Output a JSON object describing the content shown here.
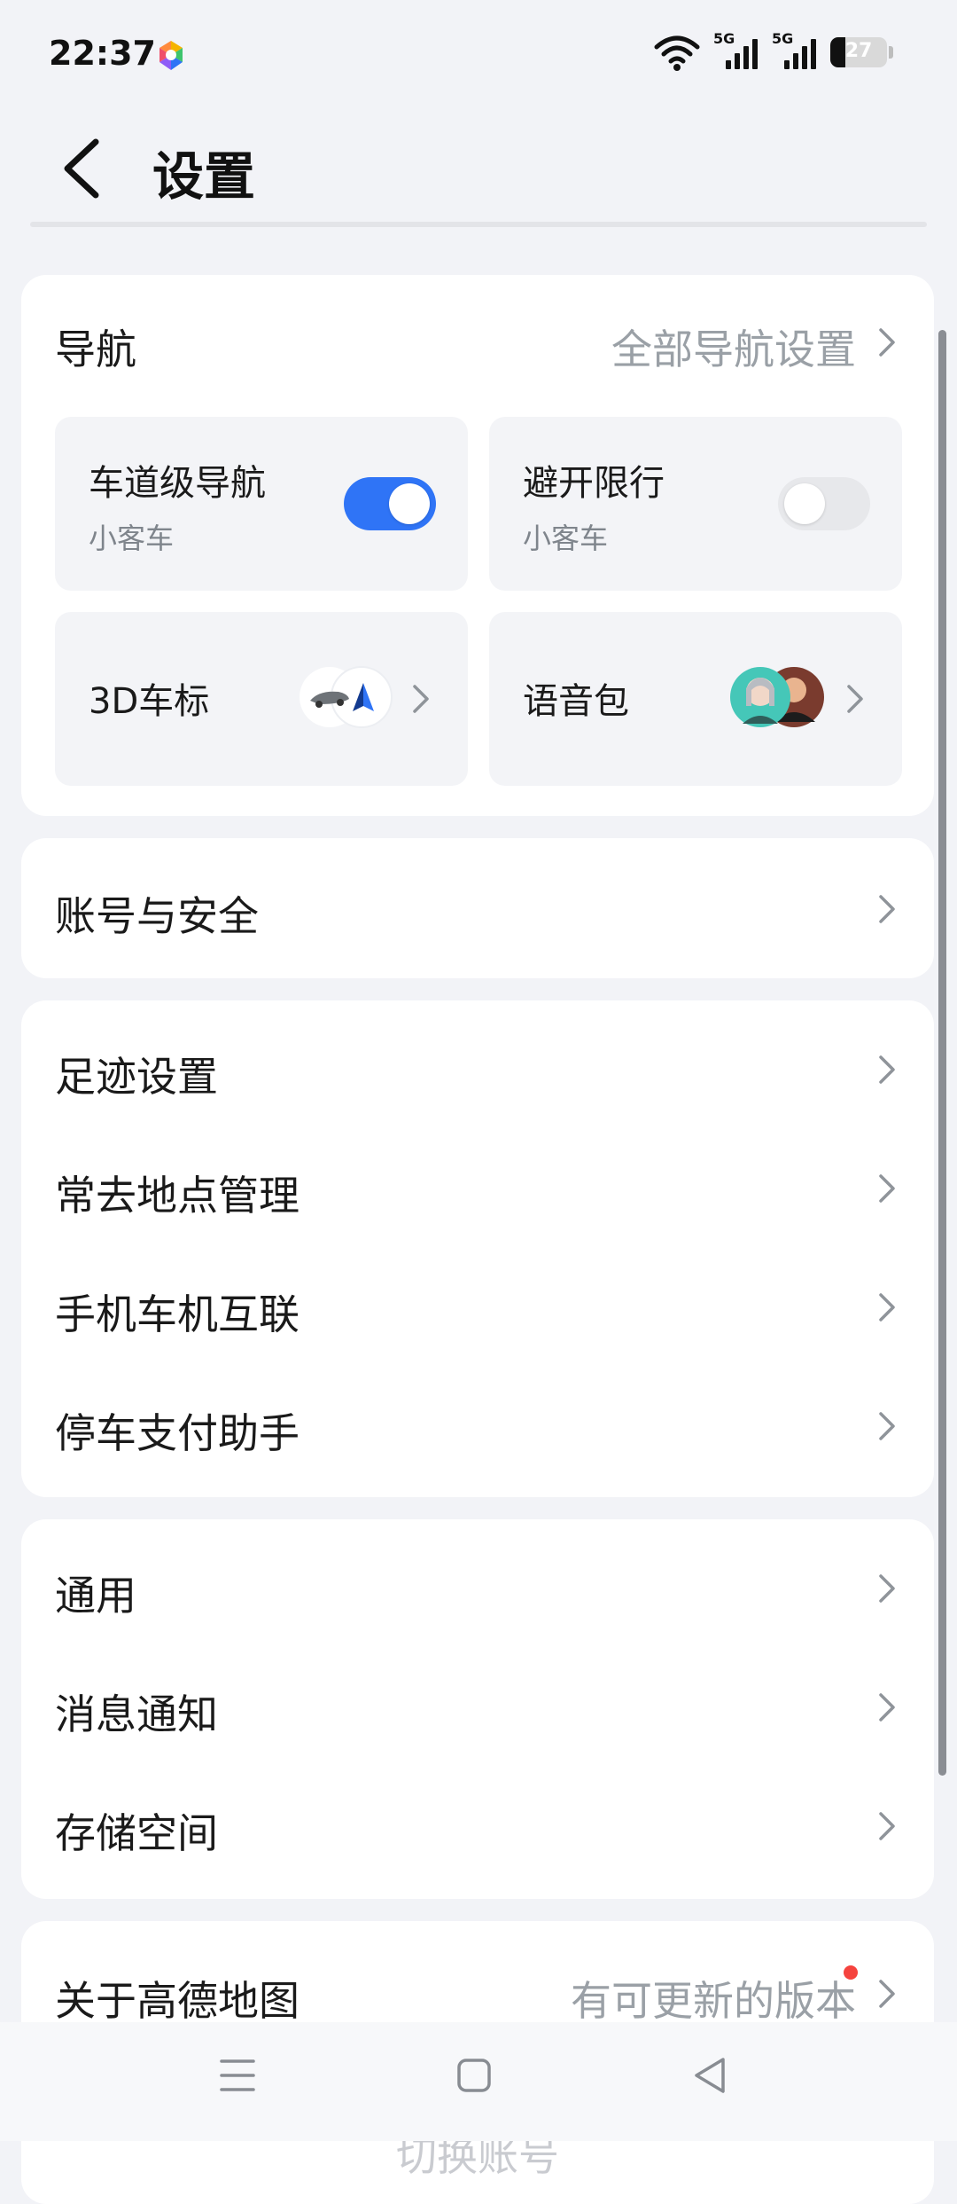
{
  "status_bar": {
    "time": "22:37",
    "network_1": "5G",
    "network_2": "5G",
    "battery": "27",
    "battery_level": 0.27
  },
  "header": {
    "title": "设置"
  },
  "navigation_card": {
    "title": "导航",
    "all_settings_link": "全部导航设置",
    "tiles": [
      {
        "title": "车道级导航",
        "subtitle": "小客车",
        "toggle_on": true
      },
      {
        "title": "避开限行",
        "subtitle": "小客车",
        "toggle_on": false
      },
      {
        "title": "3D车标"
      },
      {
        "title": "语音包"
      }
    ]
  },
  "account_card": {
    "items": [
      {
        "label": "账号与安全"
      }
    ]
  },
  "features_card": {
    "items": [
      {
        "label": "足迹设置"
      },
      {
        "label": "常去地点管理"
      },
      {
        "label": "手机车机互联"
      },
      {
        "label": "停车支付助手"
      }
    ]
  },
  "general_card": {
    "items": [
      {
        "label": "通用"
      },
      {
        "label": "消息通知"
      },
      {
        "label": "存储空间"
      }
    ]
  },
  "about_card": {
    "label": "关于高德地图",
    "update_text": "有可更新的版本"
  },
  "switch_account": {
    "label": "切换账号"
  },
  "colors": {
    "accent": "#2f74f6",
    "background": "#f2f3f7",
    "badge": "#f5433e"
  },
  "icons": [
    "back-icon",
    "wifi-icon",
    "signal-icon",
    "battery-icon",
    "chevron-right-icon",
    "car-icon",
    "compass-arrow-icon",
    "voice-avatar-icon",
    "menu-icon",
    "home-square-icon",
    "back-triangle-icon"
  ]
}
